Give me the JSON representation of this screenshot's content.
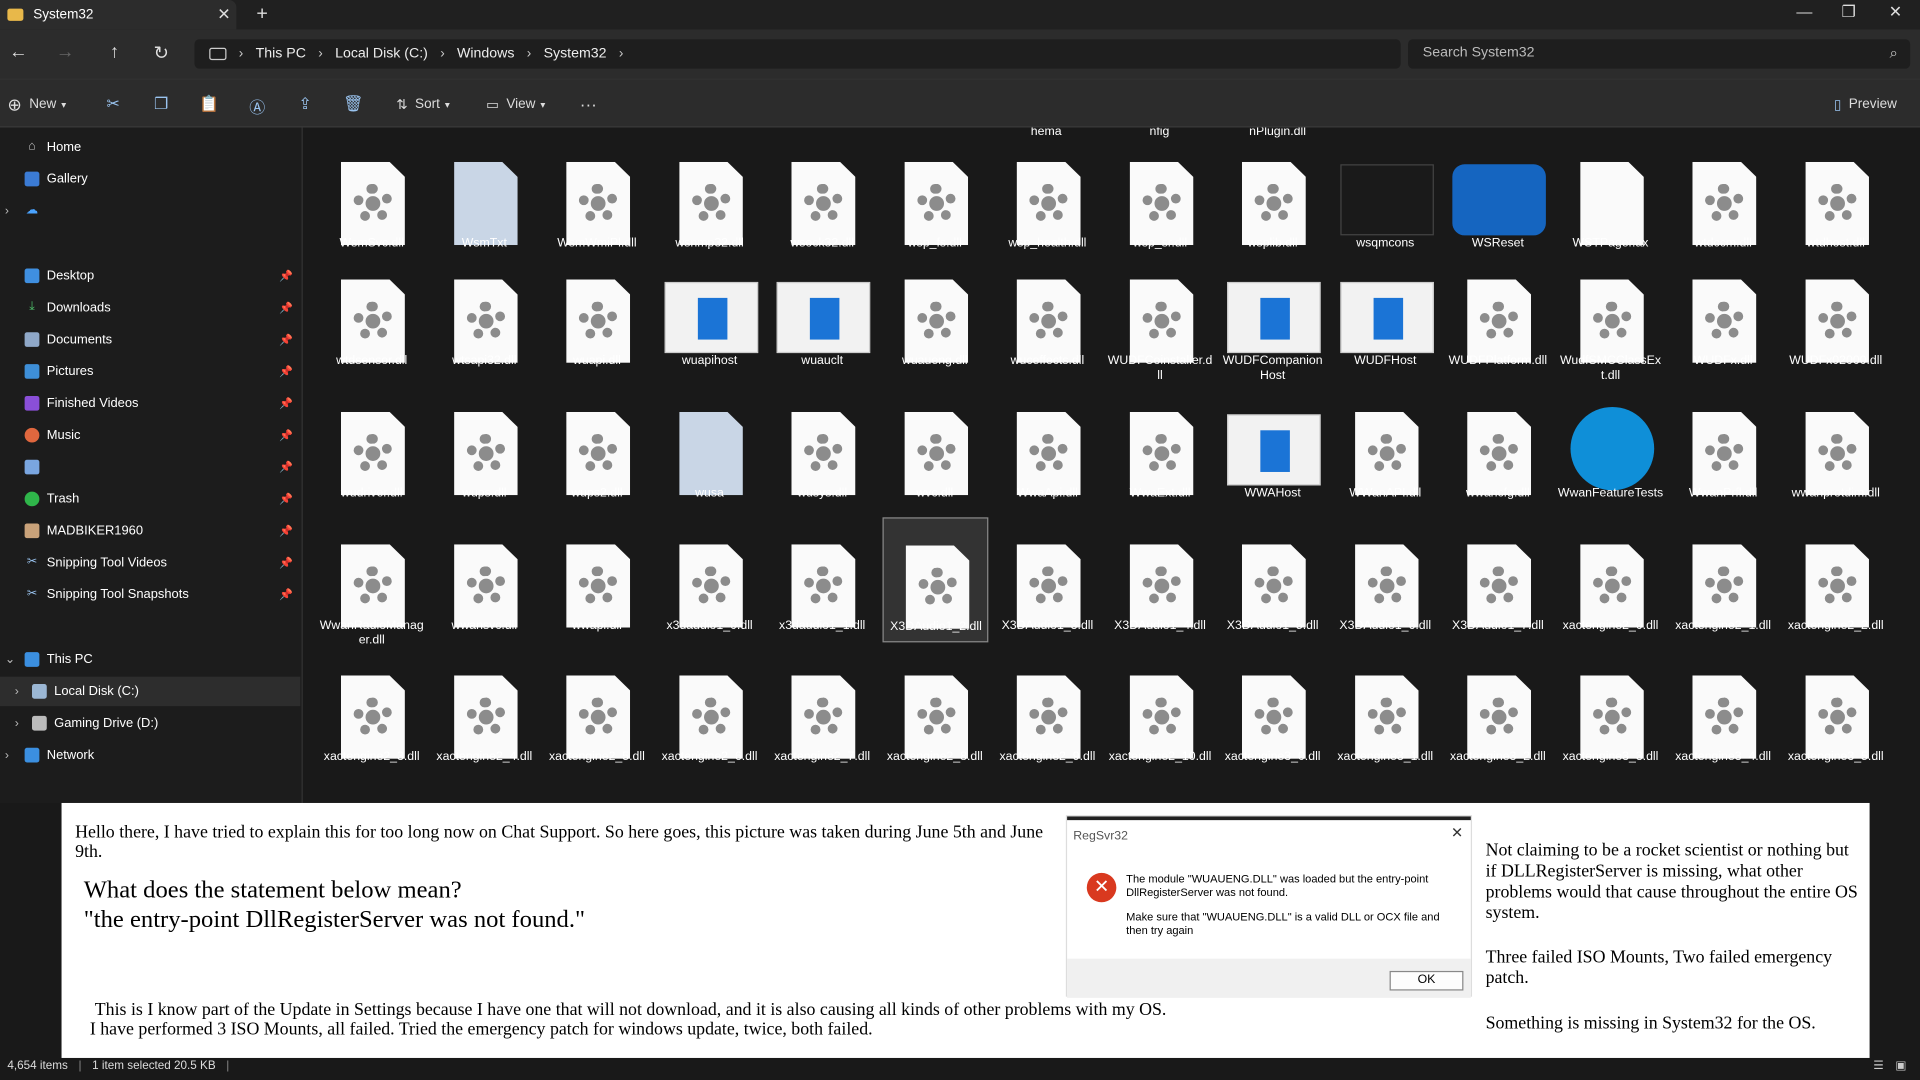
{
  "tab": {
    "title": "System32"
  },
  "breadcrumbs": [
    "This PC",
    "Local Disk (C:)",
    "Windows",
    "System32"
  ],
  "search": {
    "placeholder": "Search System32"
  },
  "toolbar": {
    "new": "New",
    "sort": "Sort",
    "view": "View",
    "more": "···",
    "preview": "Preview"
  },
  "sidebar": {
    "home": "Home",
    "gallery": "Gallery",
    "quick": [
      "Desktop",
      "Downloads",
      "Documents",
      "Pictures",
      "Finished Videos",
      "Music",
      "",
      "Trash",
      "MADBIKER1960",
      "Snipping Tool Videos",
      "Snipping Tool Snapshots"
    ],
    "this_pc": "This PC",
    "local_disk": "Local Disk (C:)",
    "gaming": "Gaming Drive (D:)",
    "network": "Network"
  },
  "partial_top": [
    "hema",
    "nfig",
    "nPlugin.dll"
  ],
  "rows": [
    [
      "WsmSvc.dll",
      "WsmTxt",
      "WsmWmiPl.dll",
      "wsnmp32.dll",
      "wsock32.dll",
      "wsp_fs.dll",
      "wsp_health.dll",
      "wsp_sr.dll",
      "wsplib.dll",
      "wsqmcons",
      "WSReset",
      "WSTPager.ax",
      "wtdccm.dll",
      "wtdhost.dll"
    ],
    [
      "wtdsensor.dll",
      "wtsapi32.dll",
      "wuapi.dll",
      "wuapihost",
      "wuauclt",
      "wuaueng.dll",
      "wuceffects.dll",
      "WUDFCoinstaller.dll",
      "WUDFCompanionHost",
      "WUDFHost",
      "WUDFPlatform.dll",
      "WudfSMCClassExt.dll",
      "WUDFx.dll",
      "WUDFx02000.dll"
    ],
    [
      "wudriver.dll",
      "wups.dll",
      "wups2.dll",
      "wusa",
      "wusys.dll",
      "wvc.dll",
      "WwaApi.dll",
      "WwaExt.dll",
      "WWAHost",
      "WWanAPI.dll",
      "wwancfg.dll",
      "WwanFeatureTests",
      "WwanPrfl.dll",
      "wwanprotdim.dll"
    ],
    [
      "WwanRadioManager.dll",
      "wwansvc.dll",
      "wwapi.dll",
      "x3daudio1_0.dll",
      "x3daudio1_1.dll",
      "X3DAudio1_2.dll",
      "X3DAudio1_3.dll",
      "X3DAudio1_4.dll",
      "X3DAudio1_5.dll",
      "X3DAudio1_6.dll",
      "X3DAudio1_7.dll",
      "xactengine2_0.dll",
      "xactengine2_1.dll",
      "xactengine2_2.dll"
    ],
    [
      "xactengine2_3.dll",
      "xactengine2_4.dll",
      "xactengine2_5.dll",
      "xactengine2_6.dll",
      "xactengine2_7.dll",
      "xactengine2_8.dll",
      "xactengine2_9.dll",
      "xactengine2_10.dll",
      "xactengine3_0.dll",
      "xactengine3_1.dll",
      "xactengine3_2.dll",
      "xactengine3_3.dll",
      "xactengine3_4.dll",
      "xactengine3_5.dll"
    ]
  ],
  "overlay": {
    "intro": "Hello there, I have tried to explain this for too long now on Chat Support. So here goes, this picture was taken during June 5th and June 9th.",
    "question": "What does the statement below mean?",
    "quote": "\"the entry-point DllRegisterServer was not found.\"",
    "body1": "This is I know part of the Update in Settings because I have one that will not download, and it is also causing all kinds of other problems with my OS.",
    "body2": "I have performed 3 ISO Mounts, all failed. Tried the emergency patch for windows update, twice, both failed.",
    "right1": "Not claiming to be a rocket scientist or nothing but if DLLRegisterServer is missing, what other problems would that cause throughout the entire OS system.",
    "right2": "Three failed ISO Mounts, Two failed emergency patch.",
    "right3": "Something is missing in System32 for the OS."
  },
  "dialog": {
    "title": "RegSvr32",
    "msg1": "The module \"WUAUENG.DLL\" was loaded but the entry-point DllRegisterServer was not found.",
    "msg2": "Make sure that \"WUAUENG.DLL\" is a valid DLL or OCX file and then try again",
    "ok": "OK"
  },
  "status": {
    "items": "4,654 items",
    "selected": "1 item selected  20.5 KB"
  }
}
